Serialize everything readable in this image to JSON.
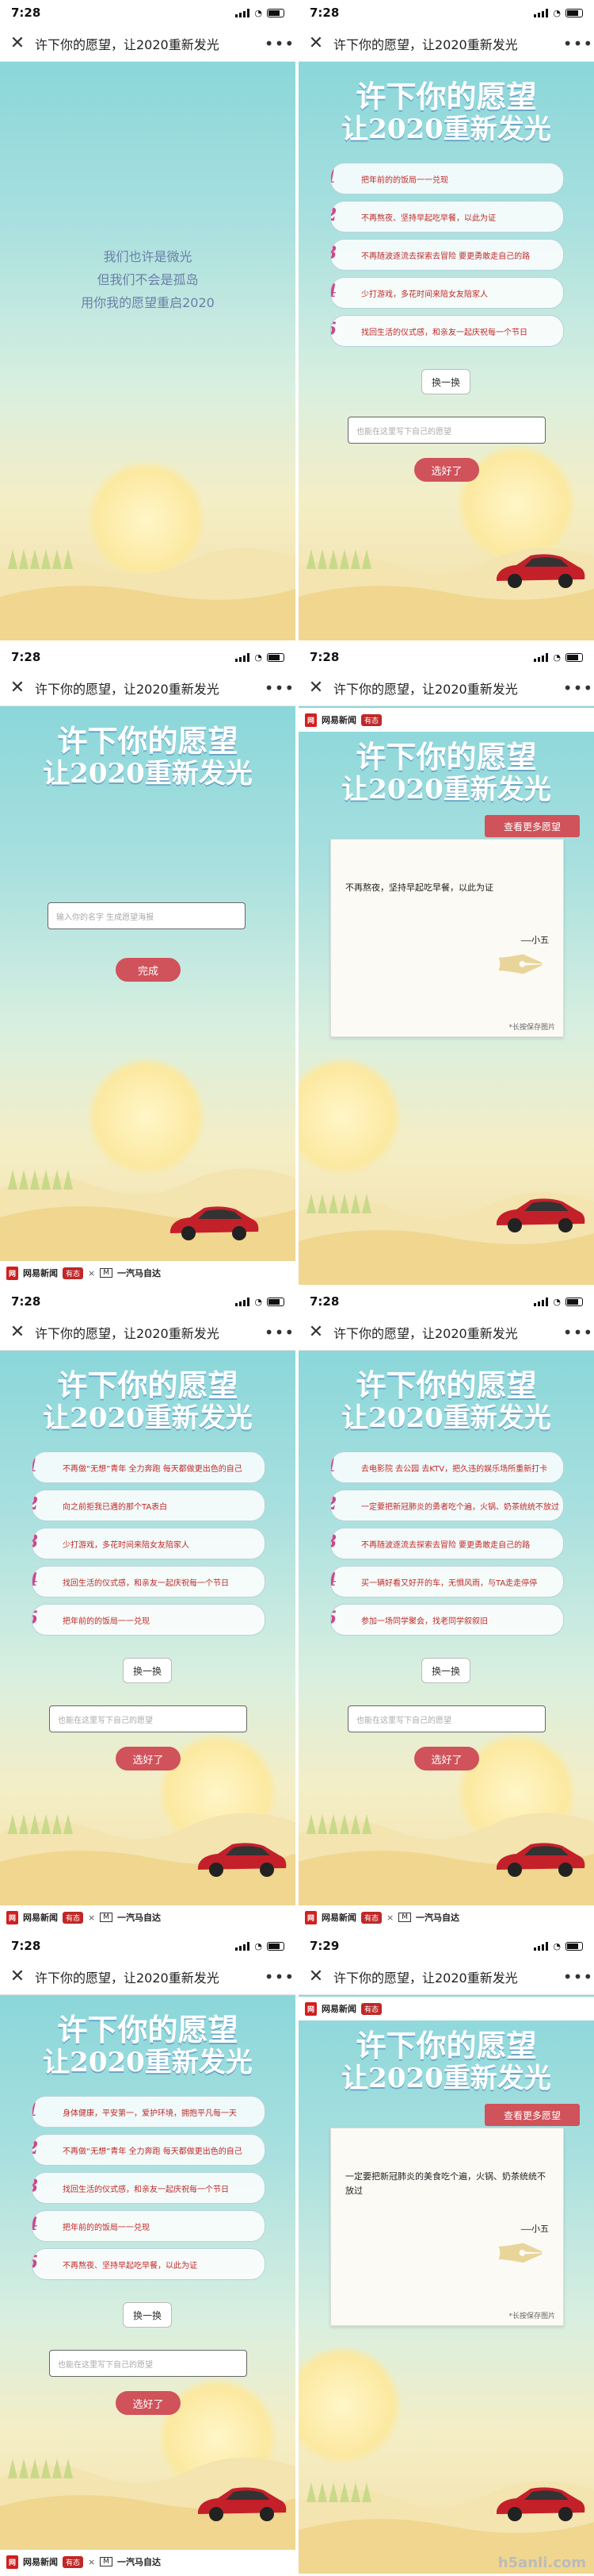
{
  "navbar": {
    "close_icon": "close-icon",
    "title": "许下你的愿望，让2020重新发光",
    "more_icon": "more-icon"
  },
  "statusbar": {
    "time_a": "7:28",
    "time_b": "7:29"
  },
  "headline": {
    "line1": "许下你的愿望",
    "line2": "让2020重新发光"
  },
  "intro": {
    "line1": "我们也许是微光",
    "line2": "但我们不会是孤岛",
    "line3": "用你我的愿望重启2020"
  },
  "swap_label": "换一换",
  "input_placeholder": "也能在这里写下自己的愿望",
  "ok_label": "选好了",
  "name_placeholder": "输入你的名字 生成愿望海报",
  "done_label": "完成",
  "see_all_label": "查看更多愿望",
  "poster_hint": "*长按保存图片",
  "brand": {
    "netease": "网易新闻",
    "pill": "有态",
    "x": "×",
    "faw": "一汽马自达"
  },
  "lists": {
    "set1": [
      "把年前的的饭局一一兑现",
      "不再熬夜、坚持早起吃早餐，以此为证",
      "不再随波逐流去探索去冒险 要更勇敢走自己的路",
      "少打游戏，多花时间来陪女友陪家人",
      "找回生活的仪式感，和亲友一起庆祝每一个节日"
    ],
    "set2": [
      "不再做“无想”青年 全力奔跑 每天都做更出色的自己",
      "向之前拒我已遇的那个TA表白",
      "少打游戏，多花时间来陪女友陪家人",
      "找回生活的仪式感，和亲友一起庆祝每一个节日",
      "把年前的的饭局一一兑现"
    ],
    "set3": [
      "去电影院 去公园 去KTV，把久违的娱乐场所重新打卡",
      "一定要把新冠肺炎的勇者吃个遍，火锅、奶茶统统不放过",
      "不再随波逐流去探索去冒险 要更勇敢走自己的路",
      "买一辆好看又好开的车，无惧风雨，与TA走走停停",
      "参加一场同学聚会，找老同学叙叙旧"
    ],
    "set4": [
      "身体健康，平安第一，爱护环境，拥抱平凡每一天",
      "不再做“无想”青年 全力奔跑 每天都做更出色的自己",
      "找回生活的仪式感，和亲友一起庆祝每一个节日",
      "把年前的的饭局一一兑现",
      "不再熬夜、坚持早起吃早餐，以此为证"
    ]
  },
  "numbers": [
    "1",
    "2",
    "3",
    "4",
    "5"
  ],
  "poster1": {
    "text": "不再熬夜，坚持早起吃早餐，以此为证",
    "sign": "——小五"
  },
  "poster2": {
    "text": "一定要把新冠肺炎的美食吃个遍，火锅、奶茶统统不放过",
    "sign": "——小五"
  },
  "watermark": "h5anli.com"
}
